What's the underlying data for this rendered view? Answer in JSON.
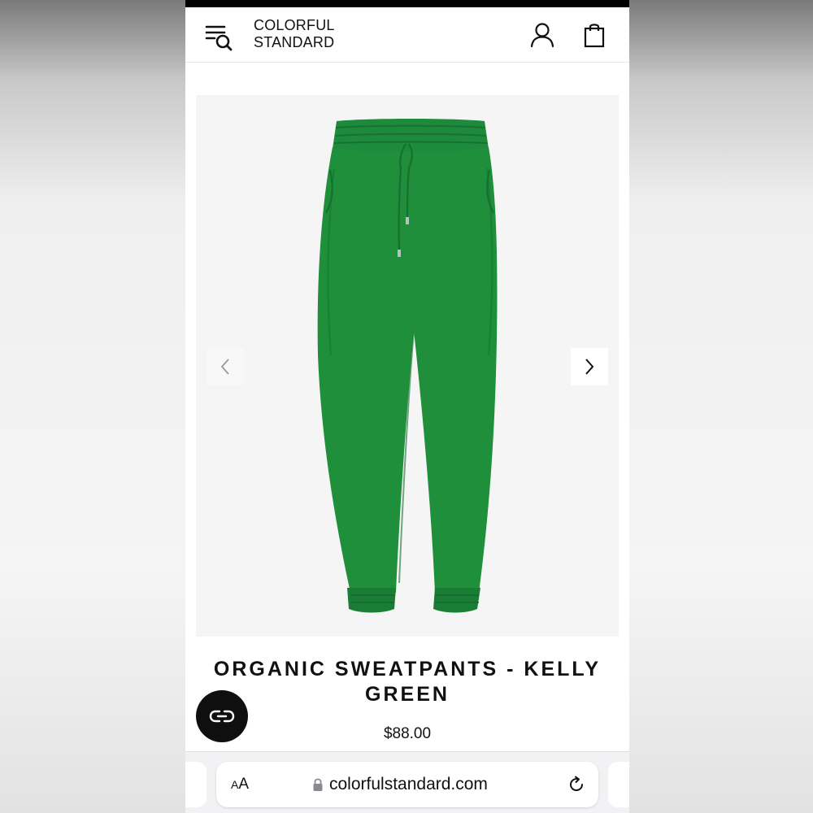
{
  "header": {
    "logo_line1": "COLORFUL",
    "logo_line2": "STANDARD",
    "icons": [
      "menu-search-icon",
      "account-icon",
      "shopping-bag-icon"
    ]
  },
  "gallery": {
    "image": "green-sweatpants",
    "prev_icon": "chevron-left-icon",
    "next_icon": "chevron-right-icon"
  },
  "product": {
    "title": "ORGANIC SWEATPANTS - KELLY GREEN",
    "price": "$88.00",
    "color": "#1f8f3c"
  },
  "chat": {
    "icon": "chat-link-icon"
  },
  "browser": {
    "aa_small": "A",
    "aa_large": "A",
    "url": "colorfulstandard.com",
    "lock_icon": "lock-icon",
    "reload_icon": "reload-icon"
  }
}
